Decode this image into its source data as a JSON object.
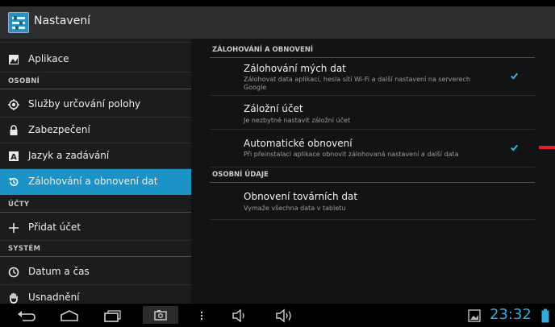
{
  "header": {
    "title": "Nastavení"
  },
  "sidebar": {
    "items": [
      {
        "label": "Aplikace",
        "icon": "apps-icon"
      },
      {
        "label": "Služby určování polohy",
        "icon": "location-icon"
      },
      {
        "label": "Zabezpečení",
        "icon": "lock-icon"
      },
      {
        "label": "Jazyk a zadávání",
        "icon": "language-icon"
      },
      {
        "label": "Zálohování a obnovení dat",
        "icon": "backup-icon",
        "active": true
      },
      {
        "label": "Přidat účet",
        "icon": "plus-icon"
      },
      {
        "label": "Datum a čas",
        "icon": "clock-icon"
      },
      {
        "label": "Usnadnění",
        "icon": "hand-icon"
      }
    ],
    "sections": [
      "OSOBNÍ",
      "ÚČTY",
      "SYSTÉM"
    ]
  },
  "main": {
    "sections": [
      "ZÁLOHOVÁNÍ A OBNOVENÍ",
      "OSOBNÍ ÚDAJE"
    ],
    "prefs": [
      {
        "title": "Zálohování mých dat",
        "summary": "Zálohovat data aplikací, hesla sítí Wi-Fi a další nastavení na serverech Google",
        "checked": true
      },
      {
        "title": "Záložní účet",
        "summary": "Je nezbytné nastavit záložní účet"
      },
      {
        "title": "Automatické obnovení",
        "summary": "Při přeinstalaci aplikace obnovit zálohovaná nastavení a další data",
        "checked": true
      },
      {
        "title": "Obnovení továrních dat",
        "summary": "Vymaže všechna data v tabletu"
      }
    ]
  },
  "statusbar": {
    "time": "23:32"
  },
  "colors": {
    "accent": "#1c93c7",
    "check": "#33b5e5",
    "clock": "#36a8dc",
    "marker": "#e21d2e"
  }
}
